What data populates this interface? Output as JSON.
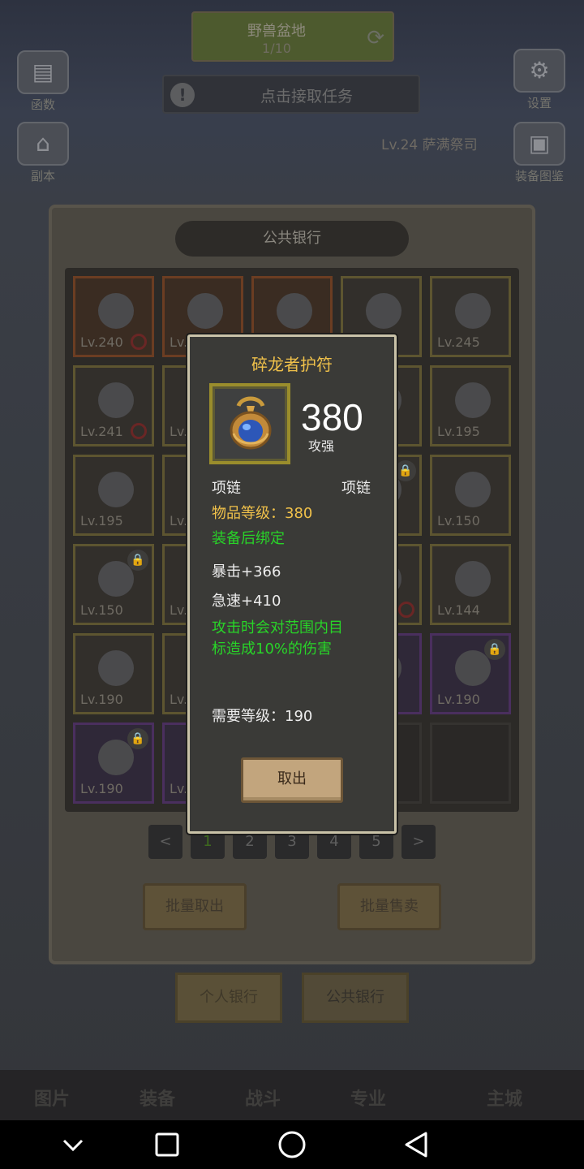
{
  "top_task": {
    "title": "野兽盆地",
    "progress": "1/10",
    "accept_label": "点击接取任务"
  },
  "side_buttons": {
    "left_1": "函数",
    "left_2": "副本",
    "right_1": "设置",
    "right_2": "装备图鉴"
  },
  "npc_line": "Lv.24 萨满祭司",
  "bank": {
    "title": "公共银行",
    "slots": [
      {
        "lv": "Lv.240",
        "style": "orange",
        "ban": true
      },
      {
        "lv": "Lv.",
        "style": "orange"
      },
      {
        "lv": "",
        "style": "orange"
      },
      {
        "lv": "",
        "style": "normal"
      },
      {
        "lv": "Lv.245",
        "style": "normal"
      },
      {
        "lv": "Lv.241",
        "style": "normal",
        "ban": true
      },
      {
        "lv": "Lv.",
        "style": "normal"
      },
      {
        "lv": "",
        "style": "normal"
      },
      {
        "lv": "",
        "style": "normal"
      },
      {
        "lv": "Lv.195",
        "style": "normal"
      },
      {
        "lv": "Lv.195",
        "style": "normal"
      },
      {
        "lv": "Lv.",
        "style": "normal"
      },
      {
        "lv": "",
        "style": "normal"
      },
      {
        "lv": "",
        "style": "normal",
        "lock": true
      },
      {
        "lv": "Lv.150",
        "style": "normal"
      },
      {
        "lv": "Lv.150",
        "style": "normal",
        "lock": true
      },
      {
        "lv": "Lv.",
        "style": "normal"
      },
      {
        "lv": "",
        "style": "normal"
      },
      {
        "lv": "",
        "style": "normal",
        "ban": true
      },
      {
        "lv": "Lv.144",
        "style": "normal"
      },
      {
        "lv": "Lv.190",
        "style": "normal"
      },
      {
        "lv": "Lv.",
        "style": "normal"
      },
      {
        "lv": "",
        "style": "normal"
      },
      {
        "lv": "",
        "style": "purple"
      },
      {
        "lv": "Lv.190",
        "style": "purple",
        "lock": true
      },
      {
        "lv": "Lv.190",
        "style": "purple",
        "lock": true
      },
      {
        "lv": "Lv.",
        "style": "purple"
      },
      {
        "lv": "",
        "style": "normal"
      },
      {
        "lv": "",
        "style": "empty"
      },
      {
        "lv": "",
        "style": "empty"
      }
    ],
    "pages": [
      "<",
      "1",
      "2",
      "3",
      "4",
      "5",
      ">"
    ],
    "batch_take": "批量取出",
    "batch_sell": "批量售卖",
    "tab_personal": "个人银行",
    "tab_public": "公共银行"
  },
  "bottom_nav": [
    "图片",
    "装备",
    "战斗",
    "专业",
    "主城"
  ],
  "item": {
    "name": "碎龙者护符",
    "score": "380",
    "score_label": "攻强",
    "slot_type": "项链",
    "item_type": "项链",
    "item_level": "物品等级：380",
    "bind": "装备后绑定",
    "stat_crit": "暴击+366",
    "stat_haste": "急速+410",
    "effect": "攻击时会对范围内目标造成10%的伤害",
    "required_level": "需要等级：190",
    "take_button": "取出"
  },
  "colors": {
    "title_gold": "#f0c14a",
    "effect_green": "#28d428",
    "frame": "#c9c2a8"
  }
}
